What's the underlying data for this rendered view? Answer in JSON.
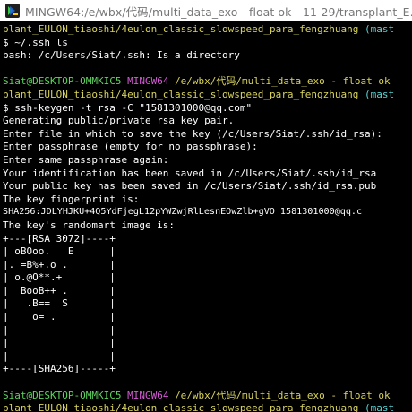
{
  "window": {
    "title": "MINGW64:/e/wbx/代码/multi_data_exo - float ok - 11-29/transplant_E...",
    "icon": "mingw-terminal-icon"
  },
  "colors": {
    "background": "#000000",
    "prompt_user": "#5fd35f",
    "prompt_shell": "#d55ad5",
    "prompt_path": "#d8d35f",
    "prompt_branch": "#5fd3d3",
    "text": "#ffffff"
  },
  "terminal": {
    "line01": "plant_EULON_tiaoshi/4eulon_classic_slowspeed_para_fengzhuang",
    "line01_branch": " (mast",
    "line02": "$ ~/.ssh ls",
    "line03": "bash: /c/Users/Siat/.ssh: Is a directory",
    "prompt1_user": "Siat@DESKTOP-OMMKIC5",
    "prompt1_shell": "MINGW64",
    "prompt1_path": "/e/wbx/代码/multi_data_exo - float ok",
    "prompt1_path2": "plant_EULON_tiaoshi/4eulon_classic_slowspeed_para_fengzhuang",
    "prompt1_branch": " (mast",
    "cmd_keygen": "$ ssh-keygen -t rsa -C \"1581301000@qq.com\"",
    "out01": "Generating public/private rsa key pair.",
    "out02": "Enter file in which to save the key (/c/Users/Siat/.ssh/id_rsa):",
    "out03": "Enter passphrase (empty for no passphrase):",
    "out04": "Enter same passphrase again:",
    "out05": "Your identification has been saved in /c/Users/Siat/.ssh/id_rsa",
    "out06": "Your public key has been saved in /c/Users/Siat/.ssh/id_rsa.pub",
    "out07": "The key fingerprint is:",
    "out08": "SHA256:JDLYHJKU+4Q5YdFjegL12pYWZwjRlLesnEOwZlb+gVO 1581301000@qq.c",
    "out09": "The key's randomart image is:",
    "art01": "+---[RSA 3072]----+",
    "art02": "| oBOoo.   E      |",
    "art03": "|. =B%+.o .       |",
    "art04": "| o.@O**.+        |",
    "art05": "|  BooB++ .       |",
    "art06": "|   .B==  S       |",
    "art07": "|    o= .         |",
    "art08": "|                 |",
    "art09": "|                 |",
    "art10": "|                 |",
    "art11": "+----[SHA256]-----+",
    "prompt2_user": "Siat@DESKTOP-OMMKIC5",
    "prompt2_shell": "MINGW64",
    "prompt2_path": "/e/wbx/代码/multi_data_exo - float ok",
    "prompt2_path2": "plant_EULON_tiaoshi/4eulon_classic_slowspeed_para_fengzhuang",
    "prompt2_branch": " (mast",
    "final_prompt": "$"
  }
}
